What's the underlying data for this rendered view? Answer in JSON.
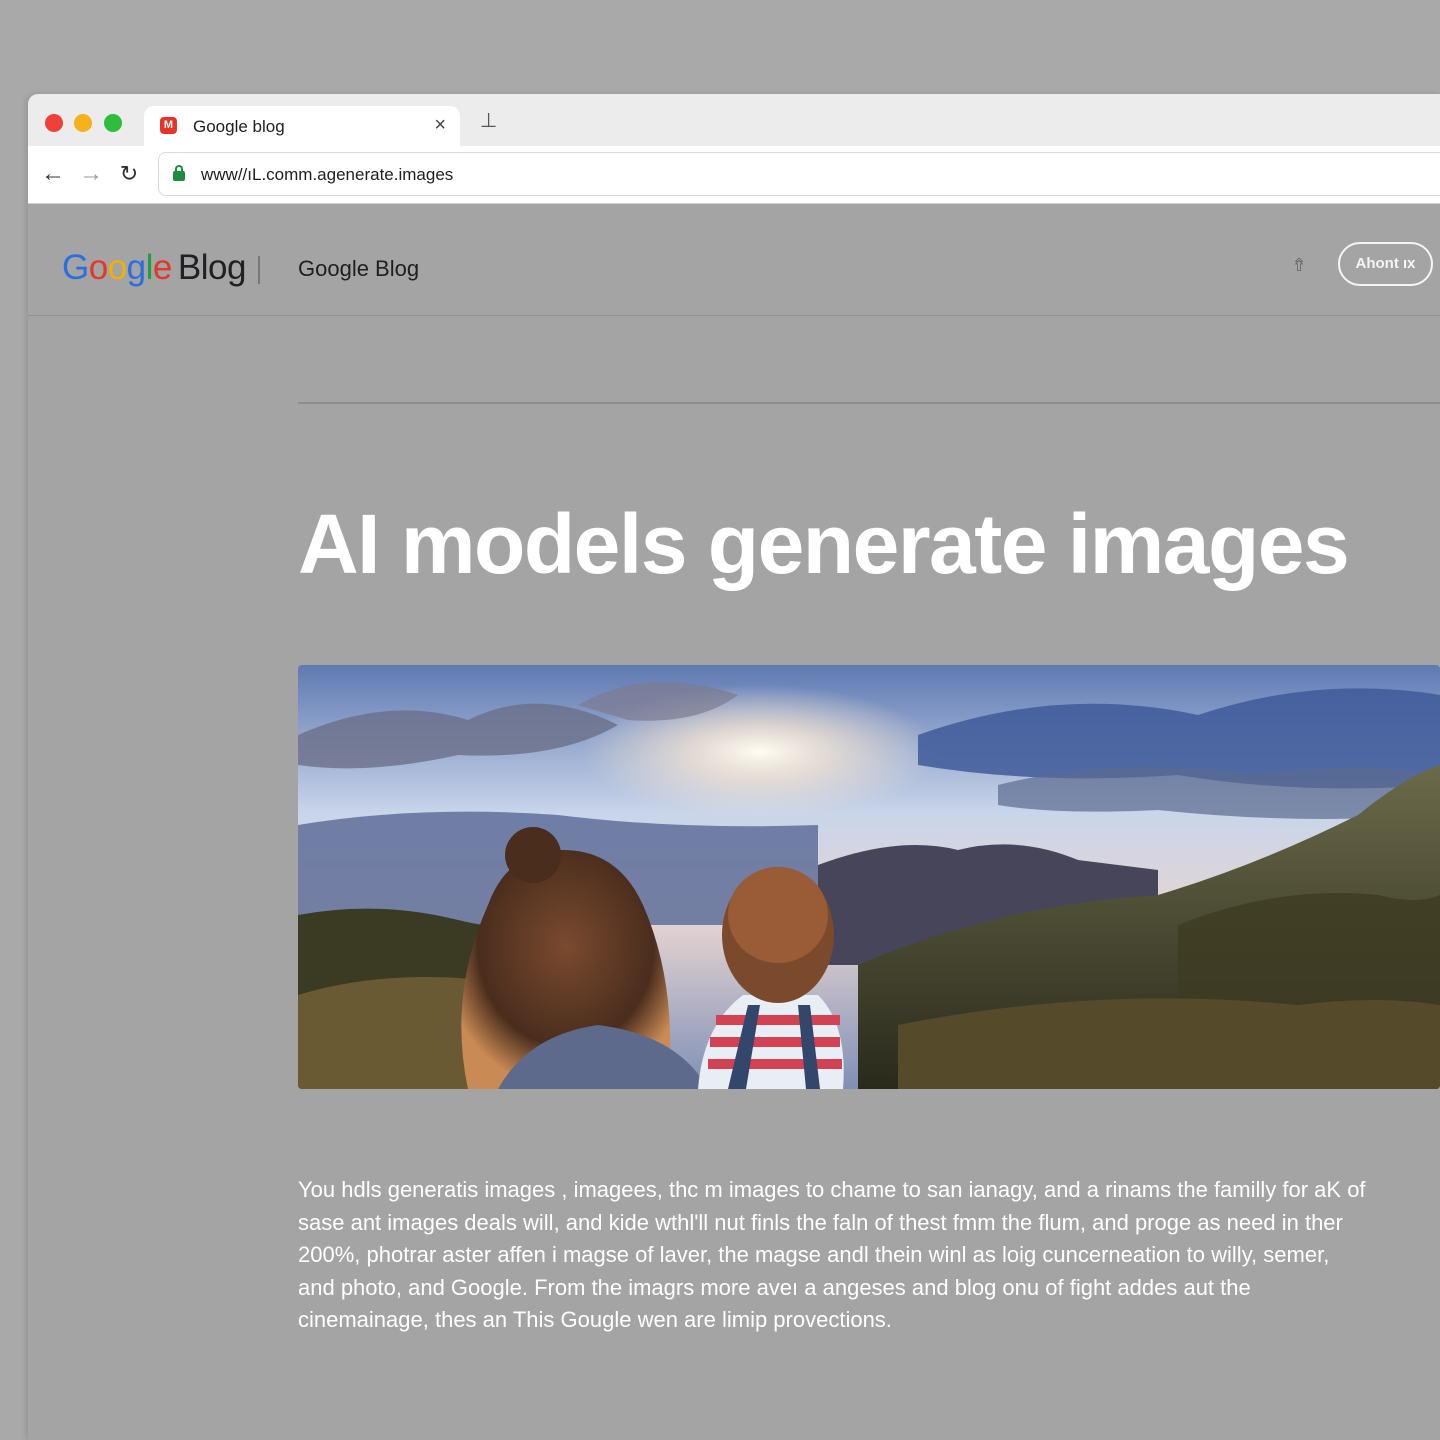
{
  "browser": {
    "tab_title": "Google blog",
    "tab_close_glyph": "×",
    "new_tab_glyph": "⊥",
    "favicon_glyph": "M",
    "url": "www//ıL.comm.agenerate.images",
    "nav": {
      "back_glyph": "←",
      "forward_glyph": "→",
      "reload_glyph": "↻"
    }
  },
  "site": {
    "logo_word": "Google",
    "logo_suffix": "Blog",
    "nav_title": "Google Blog",
    "about_button": "Ahont ıx",
    "share_icon_glyph": "⇮"
  },
  "article": {
    "headline": "AI models generate images",
    "body": "You hdls generatis images , imagees, thc m images to chame to san ianagy, and a rinams the familly for aK  of sase ant images deals will, and kide wthl'll nut finls the faln of thest fmm the flum, and proge as need in ther 200%, photrar aster affen i magse of laver, the magse andl thein winl as loig cuncerneation to willy, semer, and photo, and  Google. From the imagrs more aveı a angeses and blog onu of fight addes aut the cinemainage, thes an This Gougle wen are limip provections."
  },
  "colors": {
    "page_background": "#a4a4a4",
    "tab_strip": "#ececec",
    "traffic_red": "#f0403a",
    "traffic_yellow": "#f6b21b",
    "traffic_green": "#2fbd3c",
    "lock_green": "#1e8e3e",
    "headline_text": "#ffffff"
  },
  "hero_image": {
    "subject": "two children on a hillside watching a mountain sunset"
  }
}
